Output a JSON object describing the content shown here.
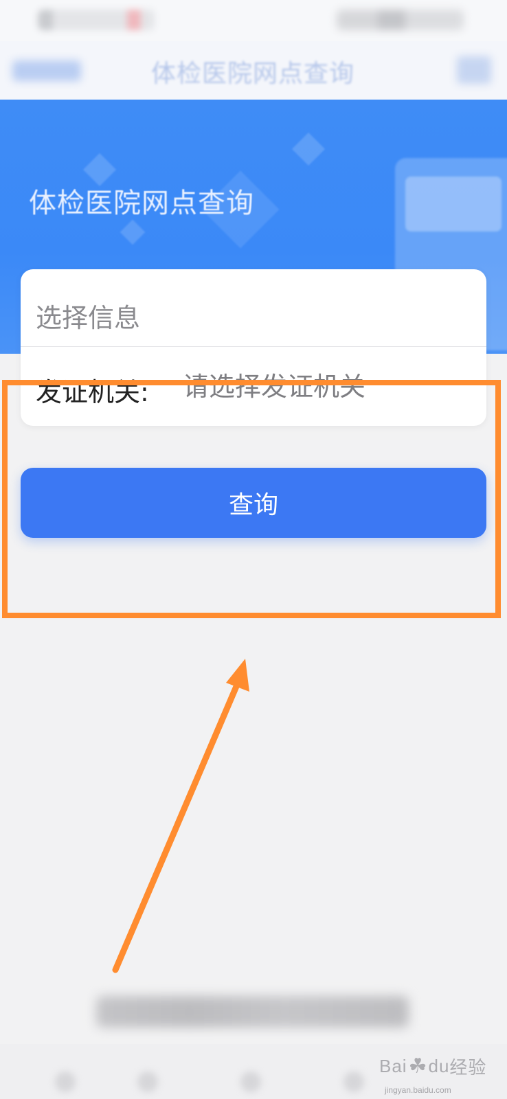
{
  "navbar": {
    "title": "体检医院网点查询"
  },
  "banner": {
    "title": "体检医院网点查询"
  },
  "form": {
    "heading": "选择信息",
    "field_label": "发证机关:",
    "field_placeholder": "请选择发证机关"
  },
  "actions": {
    "query_label": "查询"
  },
  "watermark": {
    "brand": "Bai",
    "brand_suffix": "du",
    "brand_cn": "经验",
    "url": "jingyan.baidu.com"
  },
  "colors": {
    "banner_blue": "#3b89f7",
    "button_blue": "#3c78f3",
    "highlight_orange": "#ff8c2f",
    "background": "#f2f2f3"
  }
}
